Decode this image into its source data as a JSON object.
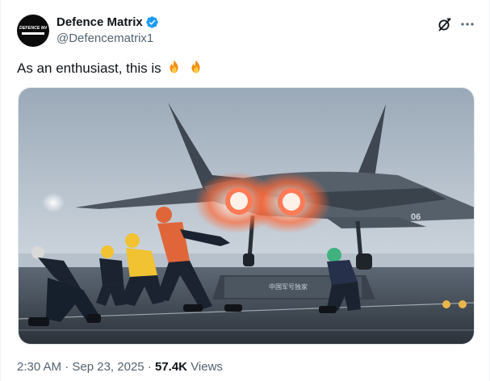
{
  "author": {
    "display_name": "Defence Matrix",
    "handle": "@Defencematrix1",
    "avatar_text": "DEFENCE MATRIX",
    "verified_color": "#1d9bf0"
  },
  "post": {
    "text": "As an enthusiast, this is",
    "emoji": [
      "fire-emoji",
      "fire-emoji"
    ]
  },
  "media": {
    "watermark": "中国军号独家",
    "tail_number": "06"
  },
  "meta": {
    "time": "2:30 AM",
    "separator": "·",
    "date": "Sep 23, 2025",
    "views_count": "57.4K",
    "views_label": "Views"
  },
  "icons": {
    "grok": "grok-icon",
    "more": "more-icon"
  }
}
